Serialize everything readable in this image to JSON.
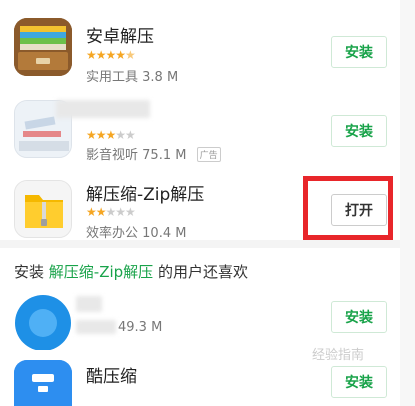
{
  "apps": [
    {
      "name": "安卓解压",
      "rating": 4.5,
      "stars_display": "★★★★★",
      "category": "实用工具",
      "size": "3.8 M",
      "action": "安装"
    },
    {
      "name": "",
      "rating": 3,
      "category": "影音视听",
      "size": "75.1 M",
      "ad_tag": "广告",
      "action": "安装"
    },
    {
      "name": "解压缩-Zip解压",
      "rating": 2,
      "category": "效率办公",
      "size": "10.4 M",
      "action": "打开"
    }
  ],
  "recommend": {
    "prefix": "安装",
    "app_name": "解压缩-Zip解压",
    "suffix": "的用户还喜欢",
    "apps": [
      {
        "size": "49.3 M",
        "action": "安装"
      },
      {
        "name": "酷压缩",
        "action": "安装"
      }
    ]
  },
  "watermark": "经验指南",
  "colors": {
    "accent_green": "#19a34a",
    "star_orange": "#f5a623",
    "highlight_red": "#e8262a"
  },
  "icons": {
    "app1": "archive-drawer-icon",
    "app2": "blurred-app-icon",
    "app3": "zip-folder-icon",
    "rec1": "blurred-blue-app-icon",
    "rec2": "blue-compress-icon"
  }
}
